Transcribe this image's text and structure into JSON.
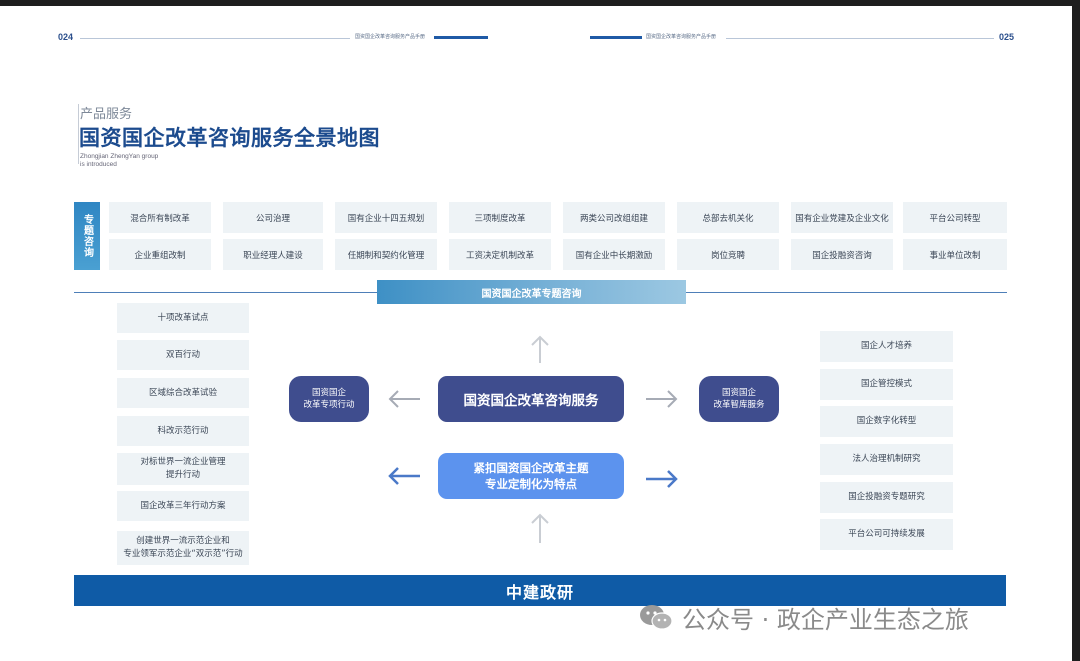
{
  "header": {
    "left_page_num": "024",
    "right_page_num": "025",
    "left_caption": "国资国企改革咨询服务产品手册",
    "right_caption": "国资国企改革咨询服务产品手册"
  },
  "title": {
    "subtitle": "产品服务",
    "main": "国资国企改革咨询服务全景地图",
    "en_line1": "Zhongjian ZhengYan group",
    "en_line2": "is introduced"
  },
  "topic": {
    "label": "专题咨询",
    "row1": [
      "混合所有制改革",
      "公司治理",
      "国有企业十四五规划",
      "三项制度改革",
      "两类公司改组组建",
      "总部去机关化",
      "国有企业党建及企业文化",
      "平台公司转型"
    ],
    "row2": [
      "企业重组改制",
      "职业经理人建设",
      "任期制和契约化管理",
      "工资决定机制改革",
      "国有企业中长期激励",
      "岗位竞聘",
      "国企投融资咨询",
      "事业单位改制"
    ]
  },
  "banner": "国资国企改革专题咨询",
  "left_items": [
    "十项改革试点",
    "双百行动",
    "区域综合改革试验",
    "科改示范行动",
    "对标世界一流企业管理\n提升行动",
    "国企改革三年行动方案",
    "创建世界一流示范企业和\n专业领军示范企业“双示范”行动"
  ],
  "right_items": [
    "国企人才培养",
    "国企管控模式",
    "国企数字化转型",
    "法人治理机制研究",
    "国企投融资专题研究",
    "平台公司可持续发展"
  ],
  "center": {
    "main": "国资国企改革咨询服务",
    "feature": "紧扣国资国企改革主题\n专业定制化为特点",
    "left_node": "国资国企\n改革专项行动",
    "right_node": "国资国企\n改革智库服务"
  },
  "footer": "中建政研",
  "watermark": "公众号 · 政企产业生态之旅",
  "colors": {
    "brand": "#1c4b8e",
    "footer": "#0f5ba6",
    "dark_node": "#3f4d8e",
    "light_node": "#5c93ee",
    "cell_bg": "#eef3f6"
  }
}
